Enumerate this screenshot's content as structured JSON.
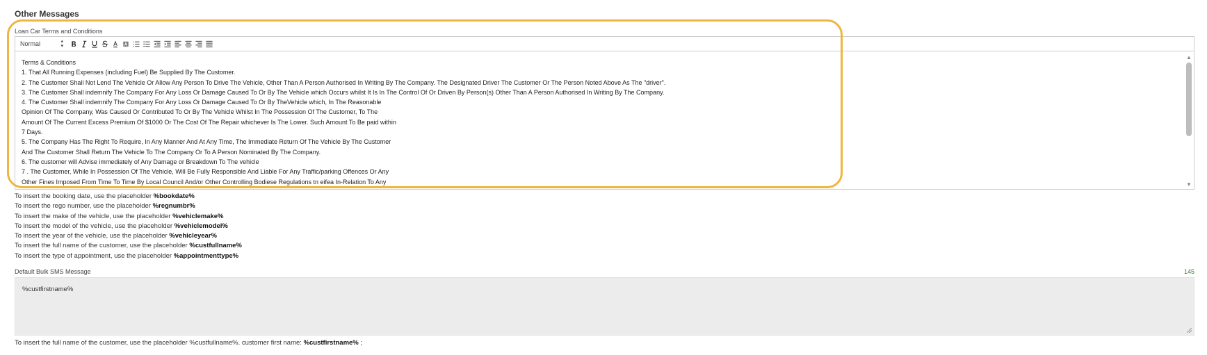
{
  "section_title": "Other Messages",
  "loan_car": {
    "label": "Loan Car Terms and Conditions",
    "toolbar": {
      "format_select": "Normal"
    },
    "lines": [
      "Terms & Conditions",
      "1. That All Running Expenses (including Fuel) Be Supplied By The Customer.",
      " 2. The Customer Shall Not Lend The Vehicle Or Allow Any Person To Drive The Vehicle, Other Than A Person Authorised In Writing By The Company. The Designated Driver The Customer Or The Person Noted Above As The \"driver\".",
      "3. The Customer Shall indemnify The Company For Any Loss Or Damage Caused To Or By The Vehicle which Occurs whilst It Is In The Control Of Or Driven By Person(s) Other Than A Person Authorised In Writing By The Company.",
      "4. The Customer Shall indemnify The Company For Any Loss Or Damage Caused To Or By TheVehicle which, In The Reasonable",
      "Opinion Of The Company, Was Caused Or Contributed To Or By The Vehicle Whilst In The Possession Of The Customer, To The",
      "Amount Of The Current Excess Premium Of $1000 Or The Cost Of The Repair whichever Is The Lower. Such Amount To Be paid within",
      "7 Days.",
      "5. The Company Has The Right To Require, In Any Manner And At Any Time, The Immediate Return Of The Vehicle By The Customer",
      "And The Customer Shall Return The Vehicle To The Company Or To A Person Nominated By The Company.",
      "6. The customer will Advise immediately of Any Damage or Breakdown To The vehicle",
      "7 . The Customer, While In Possession Of The Vehicle, Will Be Fully Responsible And Liable For Any Traffic/parking Offences Or Any",
      "Other Fines Imposed From Time To Time By Local Council And/or Other Controlling Bodiese Regulations tn eifea In-Relation To Any"
    ]
  },
  "placeholders": [
    {
      "text": "To insert the booking date, use the placeholder ",
      "code": "%bookdate%"
    },
    {
      "text": "To insert the rego number, use the placeholder ",
      "code": "%regnumbr%"
    },
    {
      "text": "To insert the make of the vehicle, use the placeholder ",
      "code": "%vehiclemake%"
    },
    {
      "text": "To insert the model of the vehicle, use the placeholder ",
      "code": "%vehiclemodel%"
    },
    {
      "text": "To insert the year of the vehicle, use the placeholder ",
      "code": "%vehicleyear%"
    },
    {
      "text": "To insert the full name of the customer, use the placeholder ",
      "code": "%custfullname%"
    },
    {
      "text": "To insert the type of appointment, use the placeholder ",
      "code": "%appointmenttype%"
    }
  ],
  "bulk_sms": {
    "label": "Default Bulk SMS Message",
    "counter": "145",
    "value": "%custfirstname%"
  },
  "bottom_note": {
    "text": "To insert the full name of the customer, use the placeholder %custfullname%. customer first name: ",
    "code": "%custfirstname%",
    "suffix": " ;"
  },
  "colors": {
    "highlight": "#f0b440",
    "counter": "#2e7d32",
    "sms_bg": "#ececec"
  }
}
